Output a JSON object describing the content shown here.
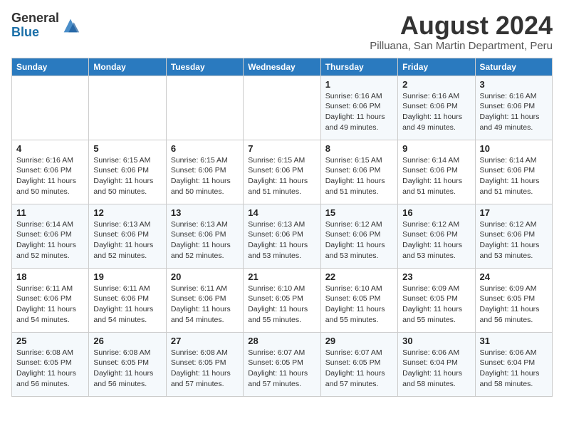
{
  "header": {
    "logo_general": "General",
    "logo_blue": "Blue",
    "main_title": "August 2024",
    "subtitle": "Pilluana, San Martin Department, Peru"
  },
  "days_of_week": [
    "Sunday",
    "Monday",
    "Tuesday",
    "Wednesday",
    "Thursday",
    "Friday",
    "Saturday"
  ],
  "weeks": [
    [
      {
        "day": "",
        "info": ""
      },
      {
        "day": "",
        "info": ""
      },
      {
        "day": "",
        "info": ""
      },
      {
        "day": "",
        "info": ""
      },
      {
        "day": "1",
        "info": "Sunrise: 6:16 AM\nSunset: 6:06 PM\nDaylight: 11 hours\nand 49 minutes."
      },
      {
        "day": "2",
        "info": "Sunrise: 6:16 AM\nSunset: 6:06 PM\nDaylight: 11 hours\nand 49 minutes."
      },
      {
        "day": "3",
        "info": "Sunrise: 6:16 AM\nSunset: 6:06 PM\nDaylight: 11 hours\nand 49 minutes."
      }
    ],
    [
      {
        "day": "4",
        "info": "Sunrise: 6:16 AM\nSunset: 6:06 PM\nDaylight: 11 hours\nand 50 minutes."
      },
      {
        "day": "5",
        "info": "Sunrise: 6:15 AM\nSunset: 6:06 PM\nDaylight: 11 hours\nand 50 minutes."
      },
      {
        "day": "6",
        "info": "Sunrise: 6:15 AM\nSunset: 6:06 PM\nDaylight: 11 hours\nand 50 minutes."
      },
      {
        "day": "7",
        "info": "Sunrise: 6:15 AM\nSunset: 6:06 PM\nDaylight: 11 hours\nand 51 minutes."
      },
      {
        "day": "8",
        "info": "Sunrise: 6:15 AM\nSunset: 6:06 PM\nDaylight: 11 hours\nand 51 minutes."
      },
      {
        "day": "9",
        "info": "Sunrise: 6:14 AM\nSunset: 6:06 PM\nDaylight: 11 hours\nand 51 minutes."
      },
      {
        "day": "10",
        "info": "Sunrise: 6:14 AM\nSunset: 6:06 PM\nDaylight: 11 hours\nand 51 minutes."
      }
    ],
    [
      {
        "day": "11",
        "info": "Sunrise: 6:14 AM\nSunset: 6:06 PM\nDaylight: 11 hours\nand 52 minutes."
      },
      {
        "day": "12",
        "info": "Sunrise: 6:13 AM\nSunset: 6:06 PM\nDaylight: 11 hours\nand 52 minutes."
      },
      {
        "day": "13",
        "info": "Sunrise: 6:13 AM\nSunset: 6:06 PM\nDaylight: 11 hours\nand 52 minutes."
      },
      {
        "day": "14",
        "info": "Sunrise: 6:13 AM\nSunset: 6:06 PM\nDaylight: 11 hours\nand 53 minutes."
      },
      {
        "day": "15",
        "info": "Sunrise: 6:12 AM\nSunset: 6:06 PM\nDaylight: 11 hours\nand 53 minutes."
      },
      {
        "day": "16",
        "info": "Sunrise: 6:12 AM\nSunset: 6:06 PM\nDaylight: 11 hours\nand 53 minutes."
      },
      {
        "day": "17",
        "info": "Sunrise: 6:12 AM\nSunset: 6:06 PM\nDaylight: 11 hours\nand 53 minutes."
      }
    ],
    [
      {
        "day": "18",
        "info": "Sunrise: 6:11 AM\nSunset: 6:06 PM\nDaylight: 11 hours\nand 54 minutes."
      },
      {
        "day": "19",
        "info": "Sunrise: 6:11 AM\nSunset: 6:06 PM\nDaylight: 11 hours\nand 54 minutes."
      },
      {
        "day": "20",
        "info": "Sunrise: 6:11 AM\nSunset: 6:06 PM\nDaylight: 11 hours\nand 54 minutes."
      },
      {
        "day": "21",
        "info": "Sunrise: 6:10 AM\nSunset: 6:05 PM\nDaylight: 11 hours\nand 55 minutes."
      },
      {
        "day": "22",
        "info": "Sunrise: 6:10 AM\nSunset: 6:05 PM\nDaylight: 11 hours\nand 55 minutes."
      },
      {
        "day": "23",
        "info": "Sunrise: 6:09 AM\nSunset: 6:05 PM\nDaylight: 11 hours\nand 55 minutes."
      },
      {
        "day": "24",
        "info": "Sunrise: 6:09 AM\nSunset: 6:05 PM\nDaylight: 11 hours\nand 56 minutes."
      }
    ],
    [
      {
        "day": "25",
        "info": "Sunrise: 6:08 AM\nSunset: 6:05 PM\nDaylight: 11 hours\nand 56 minutes."
      },
      {
        "day": "26",
        "info": "Sunrise: 6:08 AM\nSunset: 6:05 PM\nDaylight: 11 hours\nand 56 minutes."
      },
      {
        "day": "27",
        "info": "Sunrise: 6:08 AM\nSunset: 6:05 PM\nDaylight: 11 hours\nand 57 minutes."
      },
      {
        "day": "28",
        "info": "Sunrise: 6:07 AM\nSunset: 6:05 PM\nDaylight: 11 hours\nand 57 minutes."
      },
      {
        "day": "29",
        "info": "Sunrise: 6:07 AM\nSunset: 6:05 PM\nDaylight: 11 hours\nand 57 minutes."
      },
      {
        "day": "30",
        "info": "Sunrise: 6:06 AM\nSunset: 6:04 PM\nDaylight: 11 hours\nand 58 minutes."
      },
      {
        "day": "31",
        "info": "Sunrise: 6:06 AM\nSunset: 6:04 PM\nDaylight: 11 hours\nand 58 minutes."
      }
    ]
  ]
}
